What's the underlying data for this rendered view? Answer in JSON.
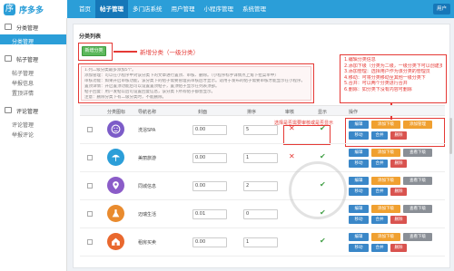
{
  "header": {
    "logo_text": "序多多",
    "nav": [
      {
        "label": "首页",
        "active": false
      },
      {
        "label": "帖子管理",
        "active": true
      },
      {
        "label": "多门店系统",
        "active": false
      },
      {
        "label": "用户管理",
        "active": false
      },
      {
        "label": "小程序管理",
        "active": false
      },
      {
        "label": "系统管理",
        "active": false
      }
    ],
    "user_label": "用户"
  },
  "sidebar": {
    "groups": [
      {
        "title": "分类管理",
        "items": [
          {
            "label": "分类管理",
            "active": true
          }
        ]
      },
      {
        "title": "帖子管理",
        "items": [
          {
            "label": "帖子管理",
            "active": false
          },
          {
            "label": "举报信息",
            "active": false
          },
          {
            "label": "置顶详情",
            "active": false
          }
        ]
      },
      {
        "title": "评论管理",
        "items": [
          {
            "label": "评论管理",
            "active": false
          },
          {
            "label": "举报评论",
            "active": false
          }
        ]
      }
    ]
  },
  "main": {
    "title": "分类列表",
    "add_button": "新增分类",
    "add_annotation": "新增分类（一级分类）",
    "notice_lines": [
      "1.列二级分类最多添加5个。",
      "添加管理：可以在小程序中对该分类下的文章进行置顶、审核、删除。（小程序标手详情点上角下拉菜单中）",
      "审核功能：如果开启审核功能，该分类下的帖子需要管理员审核后才显示。适用于发布的帖子需要审核才能显示在小程序。",
      "置顶详情：开启置顶功能后可以设置置顶帖子，置顶帖子显示在列表顶部。",
      "帖子回复：用户发帖以后可设置回复信息，该分类下所有帖子都会显示。",
      "注意：删除分类下有二级分类时，不能删除。"
    ],
    "note_box": [
      "1.编辑分类信息",
      "2.添加下级（分类为二级，一级分类下可以创建多个二级分类）",
      "3.添加管理：选择用户作为该分类的管理员",
      "4.移动：可将分类移动至其他一级分类下",
      "5.合并：可以两个分类进行合并",
      "6.删除：如分类下没有内容可删除"
    ],
    "review_annotation": "选择是否需要审核或是否显示",
    "table": {
      "headers": [
        "分类图标",
        "导航名称",
        "封面",
        "排序",
        "审核",
        "显示",
        "操作"
      ],
      "rows": [
        {
          "name": "洗浴SPA",
          "cover": "0.00",
          "sort": "5",
          "review": "✕",
          "show": "✔",
          "btn1": "编辑",
          "btn2": "添加下级",
          "btn3": "添加管理",
          "btn4": "移动",
          "btn5": "合并",
          "btn6": "删除",
          "icon": "face-icon",
          "color": "#7c5cc8"
        },
        {
          "name": "美丽旅游",
          "cover": "0.00",
          "sort": "1",
          "review": "✕",
          "show": "✔",
          "btn1": "编辑",
          "btn2": "添加下级",
          "btn3": "查看下级",
          "btn4": "移动",
          "btn5": "合并",
          "btn6": "删除",
          "icon": "umbrella-icon",
          "color": "#2b9ed8"
        },
        {
          "name": "同城信息",
          "cover": "0.00",
          "sort": "2",
          "review": "",
          "show": "✔",
          "btn1": "编辑",
          "btn2": "添加下级",
          "btn3": "查看下级",
          "btn4": "移动",
          "btn5": "合并",
          "btn6": "删除",
          "icon": "location-icon",
          "color": "#8b5cc8"
        },
        {
          "name": "迈瑞生活",
          "cover": "0.01",
          "sort": "0",
          "review": "",
          "show": "✔",
          "btn1": "编辑",
          "btn2": "添加下级",
          "btn3": "查看下级",
          "btn4": "移动",
          "btn5": "合并",
          "btn6": "删除",
          "icon": "flask-icon",
          "color": "#e98b2e"
        },
        {
          "name": "租房买卖",
          "cover": "0.00",
          "sort": "1",
          "review": "",
          "show": "✔",
          "btn1": "编辑",
          "btn2": "添加下级",
          "btn3": "查看下级",
          "btn4": "移动",
          "btn5": "合并",
          "btn6": "删除",
          "icon": "house-icon",
          "color": "#e9682e"
        }
      ]
    }
  }
}
